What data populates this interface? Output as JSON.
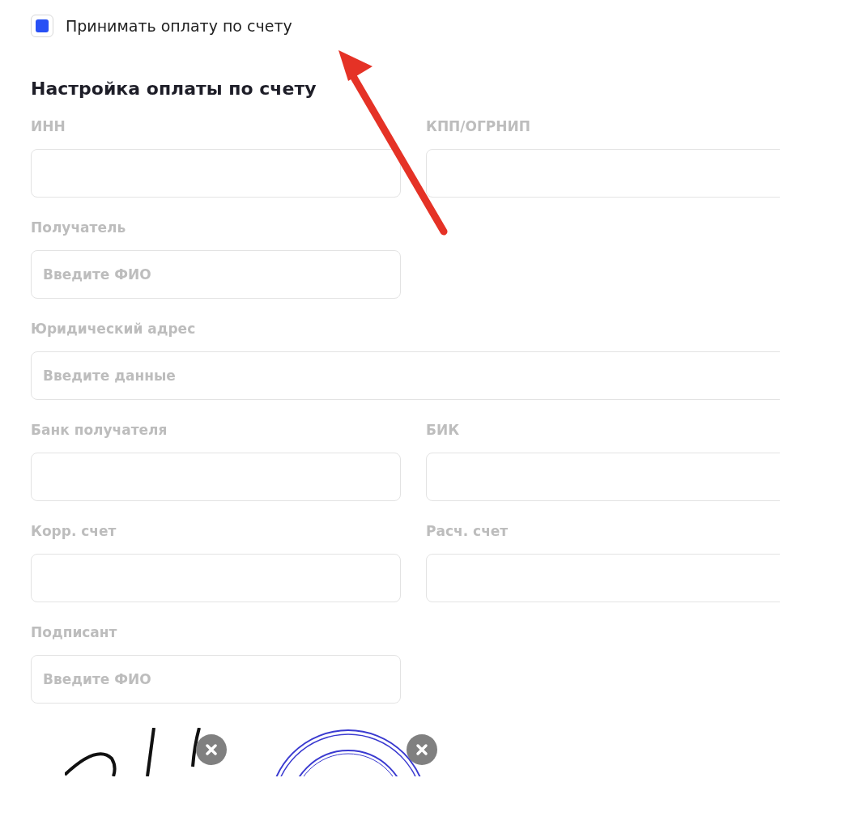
{
  "checkbox": {
    "label": "Принимать оплату по счету",
    "checked": true
  },
  "section_title": "Настройка оплаты по счету",
  "rows": [
    {
      "kind": "pair",
      "fields": [
        {
          "label": "ИНН"
        },
        {
          "label": "КПП/ОГРНИП"
        }
      ]
    },
    {
      "kind": "single",
      "fields": [
        {
          "label": "Получатель",
          "placeholder": "Введите ФИО"
        }
      ]
    },
    {
      "kind": "wide",
      "fields": [
        {
          "label": "Юридический адрес",
          "placeholder": "Введите данные"
        }
      ]
    },
    {
      "kind": "pair",
      "fields": [
        {
          "label": "Банк получателя"
        },
        {
          "label": "БИК"
        }
      ]
    },
    {
      "kind": "pair",
      "fields": [
        {
          "label": "Корр. счет"
        },
        {
          "label": "Расч. счет"
        }
      ]
    },
    {
      "kind": "single",
      "fields": [
        {
          "label": "Подписант",
          "placeholder": "Введите ФИО"
        }
      ]
    }
  ],
  "attachments": [
    {
      "kind": "signature"
    },
    {
      "kind": "stamp"
    }
  ]
}
